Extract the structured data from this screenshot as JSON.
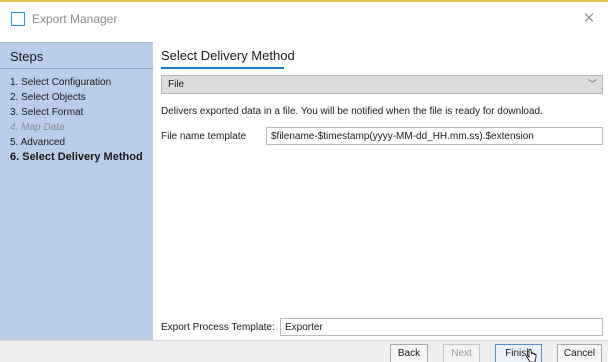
{
  "window": {
    "title": "Export Manager",
    "accent_color": "#1e78c8",
    "sidebar_color": "#b9cfe9"
  },
  "sidebar": {
    "heading": "Steps",
    "steps": [
      {
        "label": "1. Select Configuration",
        "state": "normal"
      },
      {
        "label": "2. Select Objects",
        "state": "normal"
      },
      {
        "label": "3. Select Format",
        "state": "normal"
      },
      {
        "label": "4. Map Data",
        "state": "disabled"
      },
      {
        "label": "5. Advanced",
        "state": "normal"
      },
      {
        "label": "6. Select Delivery Method",
        "state": "active"
      }
    ]
  },
  "main": {
    "heading": "Select Delivery Method",
    "delivery_method": {
      "selected": "File"
    },
    "description": "Delivers exported data in a file. You will be notified when the file is ready for download.",
    "file_name_template": {
      "label": "File name template",
      "value": "$filename-$timestamp(yyyy-MM-dd_HH.mm.ss).$extension"
    },
    "export_process_template": {
      "label": "Export Process Template:",
      "value": "Exporter"
    }
  },
  "footer": {
    "back_label": "Back",
    "next_label": "Next",
    "finish_label": "Finish",
    "cancel_label": "Cancel"
  },
  "icons": {
    "app": "window-icon",
    "close": "close-icon",
    "dropdown": "chevron-down-icon",
    "pointer": "hand-pointer-icon"
  }
}
